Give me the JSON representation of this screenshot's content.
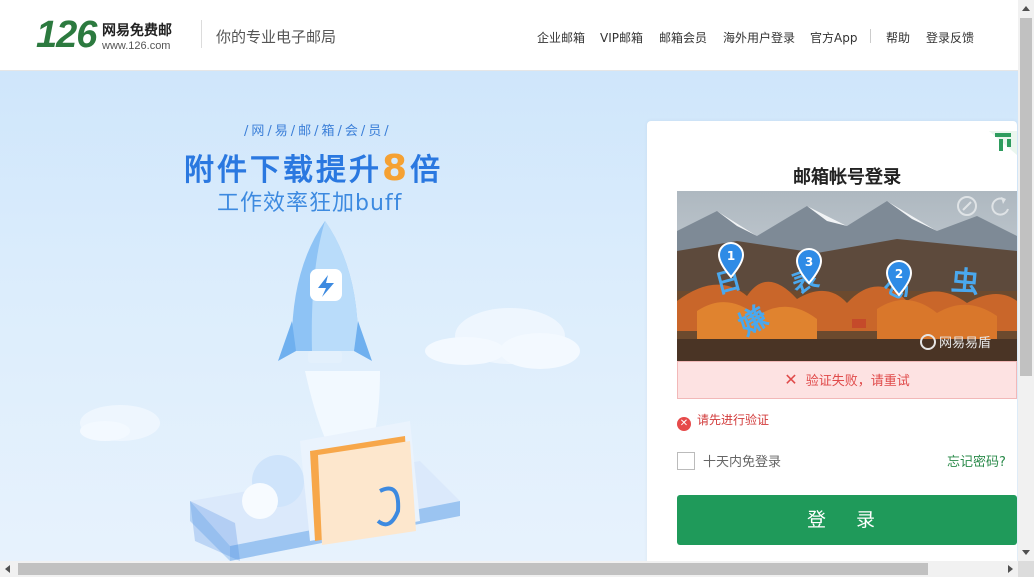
{
  "header": {
    "logo_number": "126",
    "logo_name": "网易免费邮",
    "logo_url": "www.126.com",
    "slogan": "你的专业电子邮局",
    "nav": [
      "企业邮箱",
      "VIP邮箱",
      "邮箱会员",
      "海外用户登录",
      "官方App",
      "帮助",
      "登录反馈"
    ]
  },
  "promo": {
    "top": "/网/易/邮/箱/会/员/",
    "main_before": "附件下载提升",
    "main_number": "8",
    "main_after": "倍",
    "sub": "工作效率狂加buff"
  },
  "login": {
    "title": "邮箱帐号登录",
    "captcha": {
      "markers": [
        "1",
        "3",
        "2"
      ],
      "watermark": "网易易盾",
      "error": "验证失败，请重试"
    },
    "warning": "请先进行验证",
    "remember_label": "十天内免登录",
    "forgot_label": "忘记密码?",
    "login_button": "登 录"
  },
  "colors": {
    "brand_green": "#1f9a5a",
    "logo_green": "#2c7a3f",
    "promo_blue": "#2a78e0",
    "error_red": "#e04a4a"
  }
}
